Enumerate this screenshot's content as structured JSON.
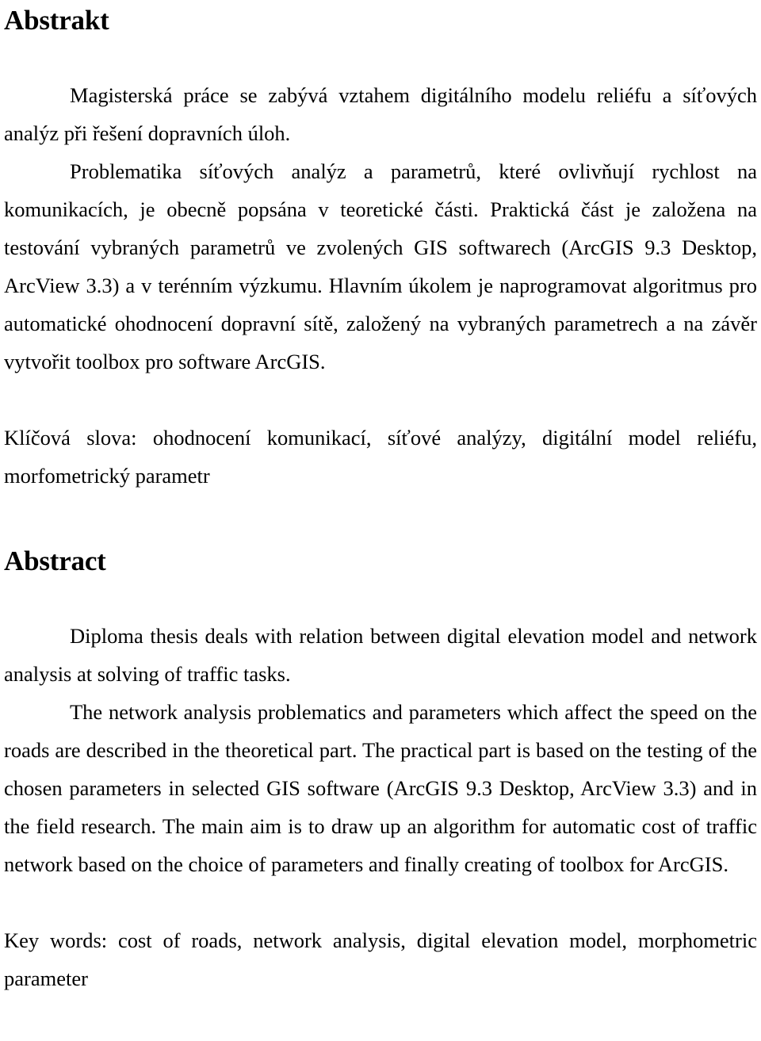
{
  "document": {
    "language_sections": [
      "Czech",
      "English"
    ],
    "text_color": "#000000",
    "background_color": "#ffffff"
  },
  "czech": {
    "heading": "Abstrakt",
    "paragraphs": [
      "Magisterská práce se zabývá vztahem digitálního modelu reliéfu a síťových analýz při řešení dopravních úloh.",
      "Problematika síťových analýz a parametrů, které ovlivňují rychlost na komunikacích, je obecně popsána v teoretické části. Praktická část je založena na testování vybraných parametrů ve zvolených GIS softwarech (ArcGIS 9.3 Desktop, ArcView 3.3) a v terénním výzkumu. Hlavním úkolem je naprogramovat algoritmus pro automatické ohodnocení dopravní sítě, založený na vybraných parametrech a na závěr vytvořit toolbox pro software ArcGIS."
    ],
    "keywords_label": "Klíčová slova:",
    "keywords_line": "Klíčová slova: ohodnocení komunikací, síťové analýzy, digitální model reliéfu, morfometrický parametr"
  },
  "english": {
    "heading": "Abstract",
    "paragraphs": [
      "Diploma thesis deals with relation between digital elevation model and network analysis at solving of traffic tasks.",
      "The network analysis problematics and parameters which affect the speed on the roads are described in the theoretical part. The practical part is based on the testing of the chosen parameters in selected GIS software (ArcGIS 9.3 Desktop, ArcView 3.3) and in the field research. The main aim is to draw up an algorithm for automatic cost of traffic network based on the choice of parameters and finally creating of toolbox for ArcGIS."
    ],
    "keywords_label": "Key words:",
    "keywords_line": "Key words: cost of roads, network analysis, digital elevation model, morphometric parameter"
  }
}
